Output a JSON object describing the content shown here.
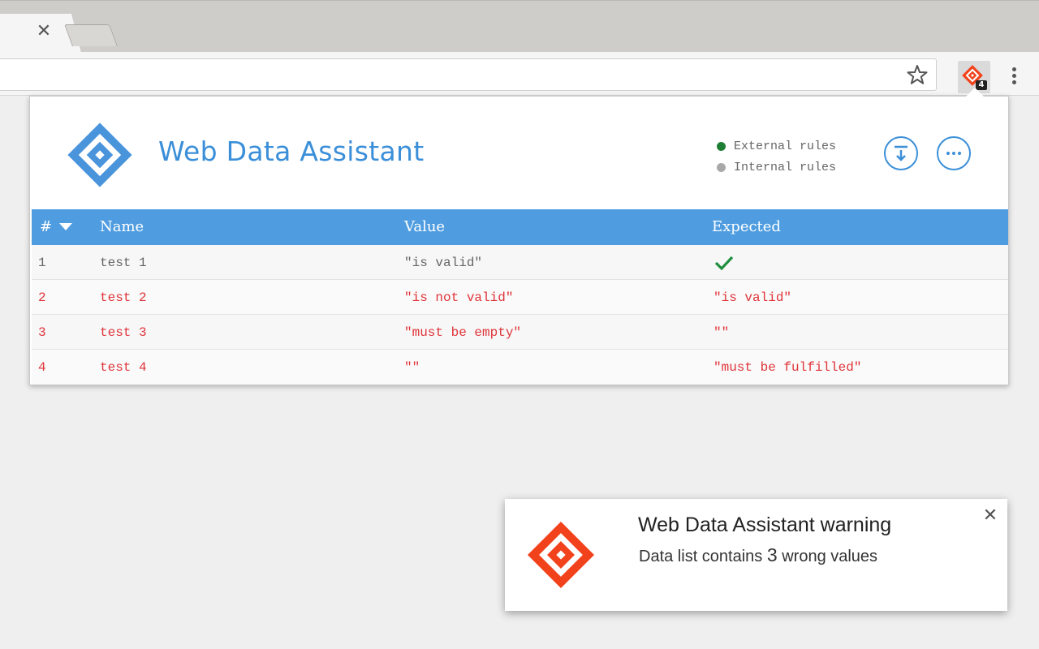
{
  "browser": {
    "tab_close_glyph": "✕",
    "star_icon": "star-icon",
    "extension_badge": "4",
    "menu_icon": "vertical-dots-icon"
  },
  "popup": {
    "title": "Web Data Assistant",
    "legend": [
      {
        "label": "External rules",
        "color": "#1e7e34"
      },
      {
        "label": "Internal rules",
        "color": "#a8a8a8"
      }
    ],
    "colors": {
      "accent": "#3b8fd9",
      "header_bg": "#4f9de0",
      "error": "#e0343a",
      "ok": "#1e8e3e"
    }
  },
  "table": {
    "headers": {
      "index": "#",
      "name": "Name",
      "value": "Value",
      "expected": "Expected"
    },
    "rows": [
      {
        "index": "1",
        "name": "test 1",
        "value": "\"is valid\"",
        "expected": "",
        "status": "ok"
      },
      {
        "index": "2",
        "name": "test 2",
        "value": "\"is not valid\"",
        "expected": "\"is valid\"",
        "status": "error"
      },
      {
        "index": "3",
        "name": "test 3",
        "value": "\"must be empty\"",
        "expected": "\"\"",
        "status": "error"
      },
      {
        "index": "4",
        "name": "test 4",
        "value": "\"\"",
        "expected": "\"must be fulfilled\"",
        "status": "error"
      }
    ]
  },
  "notification": {
    "title": "Web Data Assistant warning",
    "message_prefix": "Data list contains ",
    "message_count": "3",
    "message_suffix": " wrong values",
    "close_glyph": "✕",
    "logo_color": "#f2421c"
  }
}
